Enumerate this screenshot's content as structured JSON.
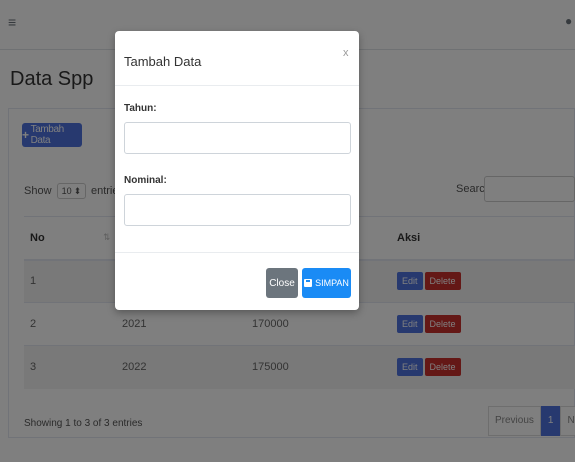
{
  "topbar": {
    "menu_icon": "≡",
    "user_icon": "👤"
  },
  "page": {
    "title": "Data Spp"
  },
  "toolbar": {
    "add_label": "Tambah Data",
    "add_icon": "+"
  },
  "table_controls": {
    "show_label": "Show",
    "entries_value": "10",
    "entries_label": "entries",
    "search_label": "Search:"
  },
  "table": {
    "headers": {
      "no": "No",
      "aksi": "Aksi"
    },
    "rows": [
      {
        "no": "1",
        "tahun": "",
        "nominal": ""
      },
      {
        "no": "2",
        "tahun": "2021",
        "nominal": "170000"
      },
      {
        "no": "3",
        "tahun": "2022",
        "nominal": "175000"
      }
    ],
    "edit_label": "Edit",
    "delete_label": "Delete"
  },
  "footer": {
    "info": "Showing 1 to 3 of 3 entries",
    "prev": "Previous",
    "page": "1",
    "next": "Next"
  },
  "modal": {
    "title": "Tambah Data",
    "close_symbol": "x",
    "tahun_label": "Tahun:",
    "nominal_label": "Nominal:",
    "tahun_value": "",
    "nominal_value": "",
    "close_btn": "Close",
    "save_btn": "SIMPAN"
  },
  "colors": {
    "primary": "#4e73df",
    "danger": "#c9302c",
    "secondary": "#6c757d",
    "save": "#1a8bf5"
  }
}
